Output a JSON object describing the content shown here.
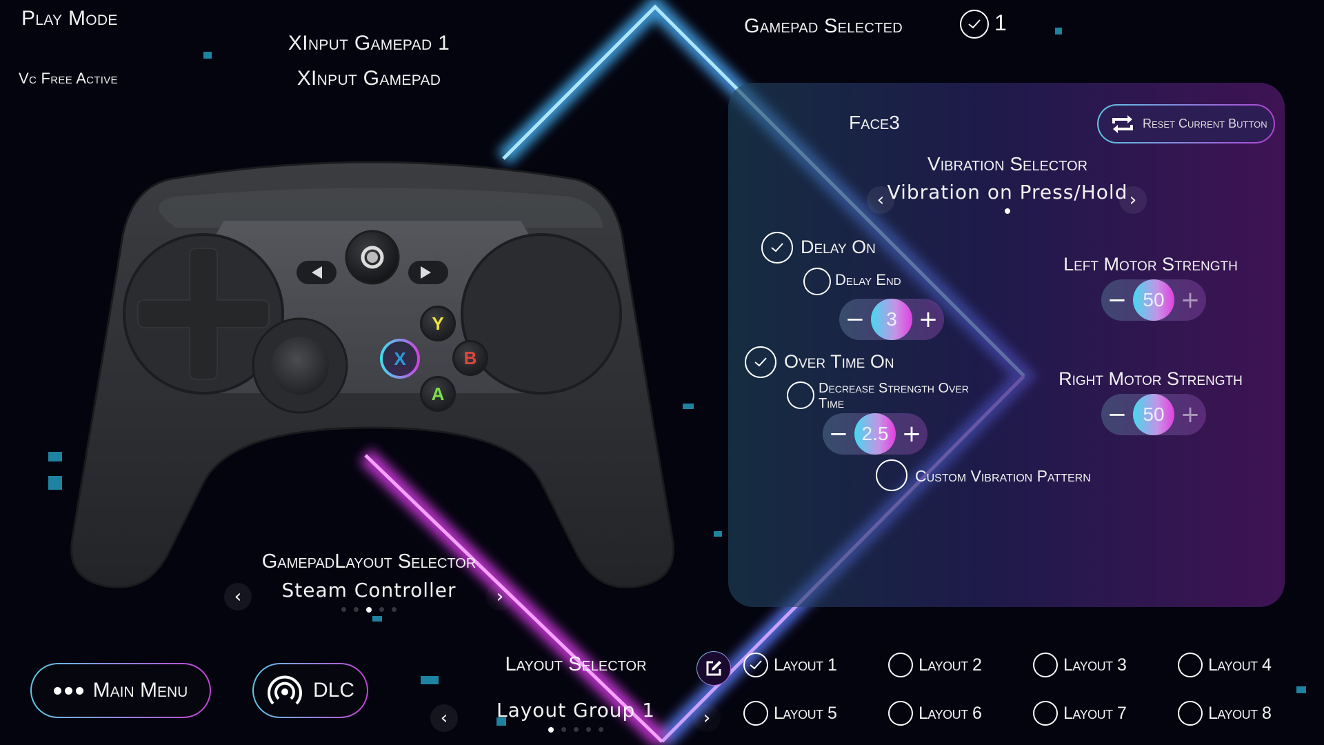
{
  "header": {
    "play_mode": "Play Mode",
    "vc_status": "Vc Free Active",
    "gamepad_name": "XInput Gamepad 1",
    "gamepad_type": "XInput Gamepad",
    "gamepad_selected_label": "Gamepad Selected",
    "gamepad_selected_checked": true,
    "gamepad_selected_number": "1"
  },
  "controller": {
    "buttons": {
      "y": "Y",
      "x": "X",
      "b": "B",
      "a": "A"
    },
    "selected_button": "X",
    "colors": {
      "y": "#f3e43a",
      "x": "#2a9fd8",
      "b": "#e0463a",
      "a": "#7fe04a"
    }
  },
  "gamepad_layout_selector": {
    "title": "GamepadLayout Selector",
    "value": "Steam Controller",
    "page_count": 5,
    "active_page": 3
  },
  "panel": {
    "button_name": "Face3",
    "reset_label": "Reset Current Button",
    "vibration_selector": {
      "title": "Vibration Selector",
      "value": "Vibration on Press/Hold",
      "page_count": 1,
      "active_page": 1
    },
    "delay_on": {
      "label": "Delay On",
      "checked": true
    },
    "delay_end": {
      "label": "Delay End",
      "checked": false
    },
    "delay_value": "3",
    "over_time_on": {
      "label": "Over Time On",
      "checked": true
    },
    "decrease_strength": {
      "label": "Decrease Strength Over Time",
      "checked": false
    },
    "over_time_value": "2.5",
    "custom_pattern": {
      "label": "Custom Vibration Pattern",
      "checked": false
    },
    "left_motor": {
      "label": "Left Motor Strength",
      "value": "50"
    },
    "right_motor": {
      "label": "Right Motor Strength",
      "value": "50"
    },
    "stepper_minus": "−",
    "stepper_plus": "+"
  },
  "bottom": {
    "main_menu_label": "Main Menu",
    "dlc_label": "DLC",
    "layout_selector": {
      "title": "Layout Selector",
      "value": "Layout Group 1",
      "page_count": 5,
      "active_page": 1
    },
    "layouts": [
      {
        "label": "Layout 1",
        "checked": true
      },
      {
        "label": "Layout 2",
        "checked": false
      },
      {
        "label": "Layout 3",
        "checked": false
      },
      {
        "label": "Layout 4",
        "checked": false
      },
      {
        "label": "Layout 5",
        "checked": false
      },
      {
        "label": "Layout 6",
        "checked": false
      },
      {
        "label": "Layout 7",
        "checked": false
      },
      {
        "label": "Layout 8",
        "checked": false
      }
    ]
  },
  "theme": {
    "accent_cyan": "#5ec8e5",
    "accent_magenta": "#c244d6",
    "background": "#04040f"
  }
}
